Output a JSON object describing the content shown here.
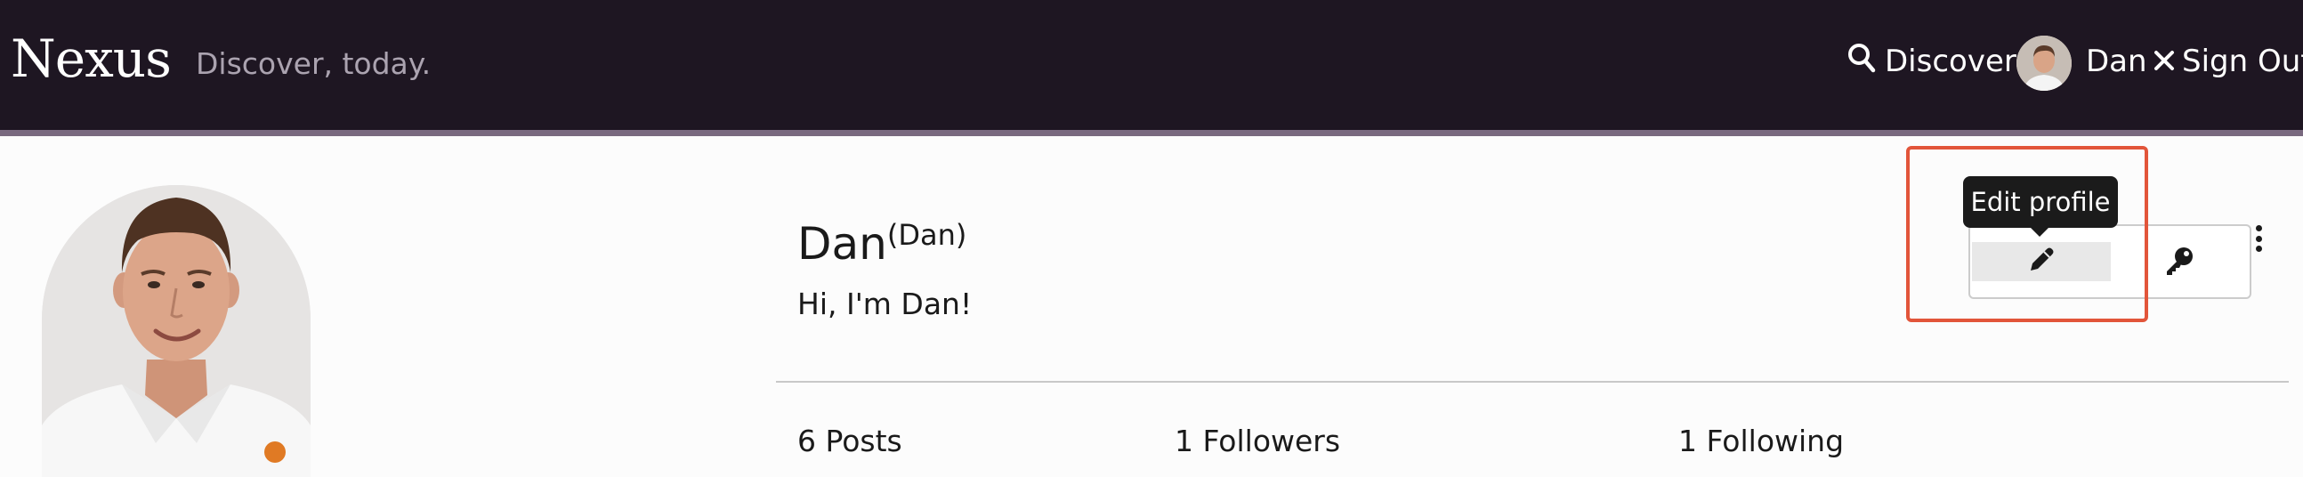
{
  "header": {
    "brand": "Nexus",
    "tagline": "Discover, today.",
    "discover_label": "Discover",
    "user_name": "Dan",
    "signout_label": "Sign Out"
  },
  "profile": {
    "name": "Dan",
    "username": "(Dan)",
    "bio": "Hi, I'm Dan!"
  },
  "stats": {
    "posts": "6 Posts",
    "followers": "1 Followers",
    "following": "1 Following"
  },
  "actions": {
    "edit_tooltip": "Edit profile"
  },
  "colors": {
    "navbar_bg": "#1e1622",
    "nav_stripe": "#79697f",
    "highlight": "#e2553a",
    "tooltip_bg": "#1b1b1b"
  },
  "icons": {
    "discover": "search-icon",
    "signout": "close-icon",
    "edit": "pencil-icon",
    "key": "key-icon",
    "more": "more-vertical-icon"
  }
}
